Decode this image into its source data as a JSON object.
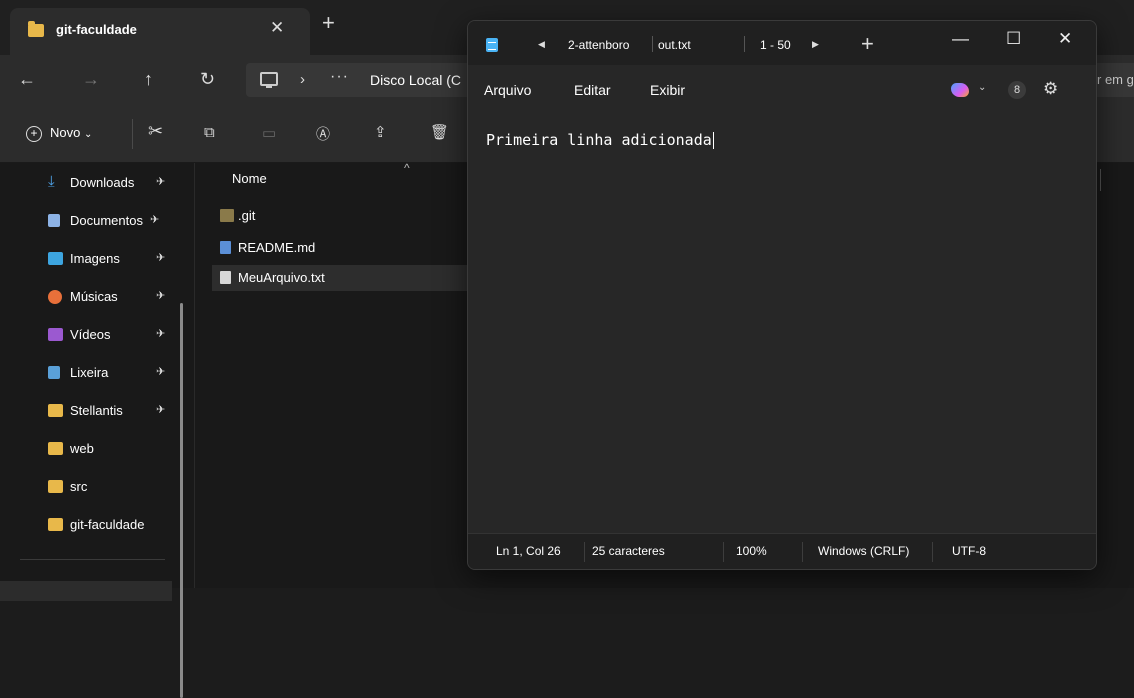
{
  "explorer": {
    "tab_title": "git-faculdade",
    "tab_close": "✕",
    "tab_new": "+",
    "nav": {
      "back": "←",
      "forward": "→",
      "up": "↑",
      "refresh": "↻"
    },
    "address": {
      "separator": "›",
      "more": "···",
      "path": "Disco Local (C"
    },
    "search_fragment": "r em g",
    "command_bar": {
      "new_label": "Novo",
      "new_chevron": "⌄",
      "new_plus": "+"
    },
    "sidebar": [
      {
        "label": "Downloads",
        "icon": "download-arrow-icon",
        "pinned": true,
        "pin": "📌",
        "color": "#4fa3e8"
      },
      {
        "label": "Documentos",
        "icon": "document-icon",
        "pinned": true,
        "pin": "📌",
        "color": "#8db3e6"
      },
      {
        "label": "Imagens",
        "icon": "image-icon",
        "pinned": true,
        "pin": "📌",
        "color": "#3da5e0"
      },
      {
        "label": "Músicas",
        "icon": "music-icon",
        "pinned": true,
        "pin": "📌",
        "color": "#e8703a"
      },
      {
        "label": "Vídeos",
        "icon": "video-icon",
        "pinned": true,
        "pin": "📌",
        "color": "#9b59d0"
      },
      {
        "label": "Lixeira",
        "icon": "recycle-bin-icon",
        "pinned": true,
        "pin": "📌",
        "color": "#5aa0d8"
      },
      {
        "label": "Stellantis",
        "icon": "folder-icon",
        "pinned": true,
        "pin": "📌",
        "color": "#e8b84a"
      },
      {
        "label": "web",
        "icon": "folder-icon",
        "pinned": false,
        "pin": "",
        "color": "#e8b84a"
      },
      {
        "label": "src",
        "icon": "folder-icon",
        "pinned": false,
        "pin": "",
        "color": "#e8b84a"
      },
      {
        "label": "git-faculdade",
        "icon": "folder-icon",
        "pinned": false,
        "pin": "",
        "color": "#e8b84a"
      }
    ],
    "files": {
      "column_header": "Nome",
      "sort_indicator": "^",
      "rows": [
        {
          "name": ".git",
          "icon": "folder-icon",
          "color": "#8a7a4a",
          "selected": false
        },
        {
          "name": "README.md",
          "icon": "markdown-file-icon",
          "color": "#5b8fd6",
          "selected": false
        },
        {
          "name": "MeuArquivo.txt",
          "icon": "text-file-icon",
          "color": "#d8d8d8",
          "selected": true
        }
      ]
    }
  },
  "notepad": {
    "tabs": [
      {
        "label": "2-attenboro"
      },
      {
        "label": "out.txt"
      }
    ],
    "tab_prev": "◀",
    "tab_next": "▶",
    "tab_count": "1 - 50",
    "new_tab": "+",
    "window_buttons": {
      "minimize": "—",
      "maximize": "☐",
      "close": "✕"
    },
    "menu": {
      "file": "Arquivo",
      "edit": "Editar",
      "view": "Exibir"
    },
    "copilot_chevron": "⌄",
    "profile_glyph": "8",
    "settings_glyph": "⚙",
    "content": "Primeira linha adicionada",
    "status": {
      "position": "Ln 1, Col 26",
      "chars": "25 caracteres",
      "zoom": "100%",
      "line_endings": "Windows (CRLF)",
      "encoding": "UTF-8"
    }
  }
}
